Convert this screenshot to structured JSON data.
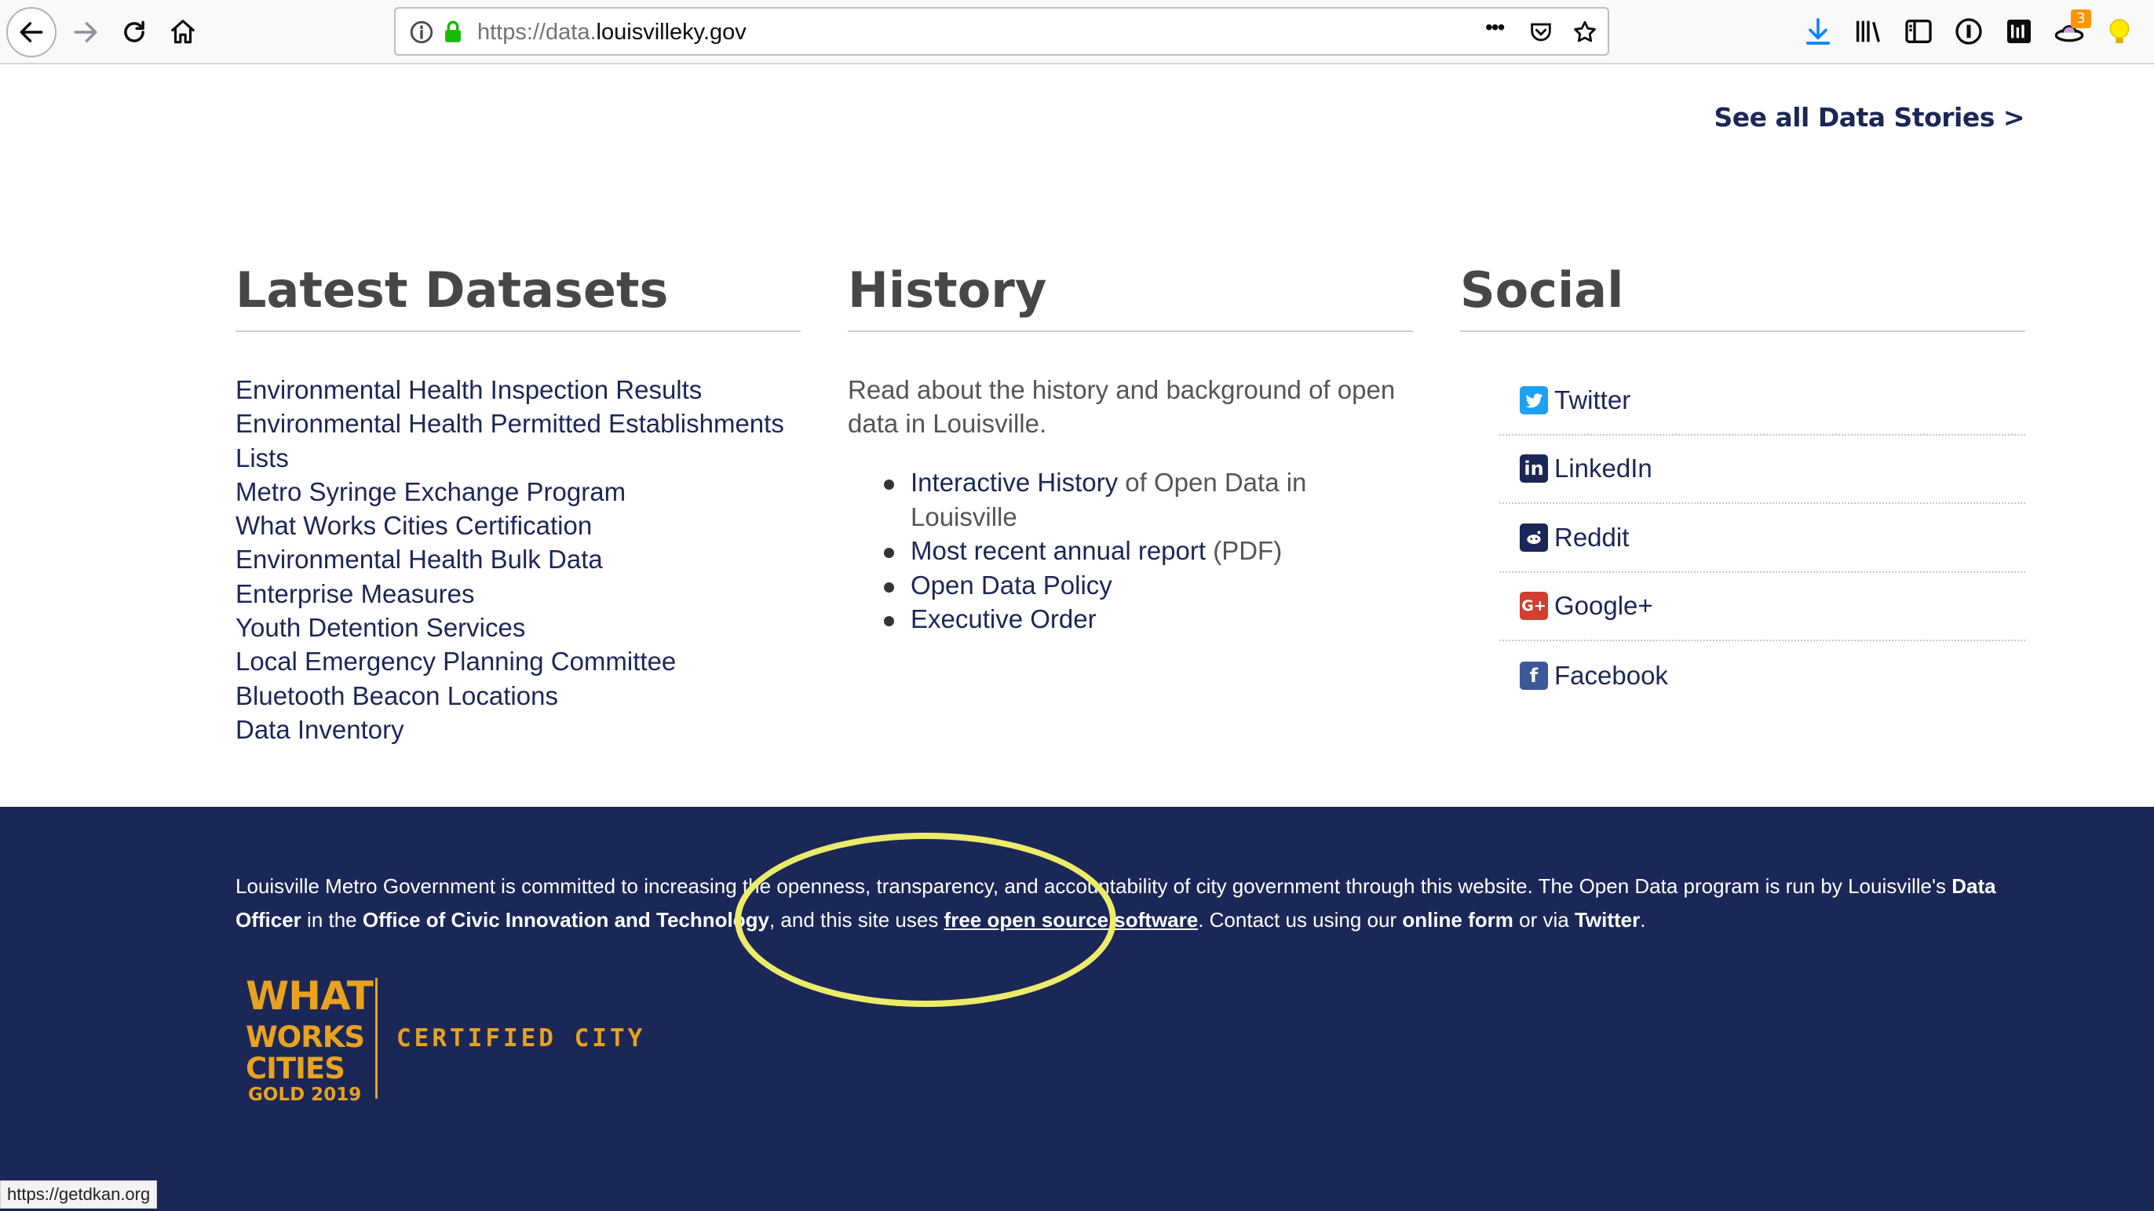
{
  "browser": {
    "url_prefix": "https://data.",
    "url_host": "louisvilleky.gov",
    "overflow_glyph": "•••",
    "notification_count": "3",
    "status_url": "https://getdkan.org"
  },
  "data_stories": {
    "link_label": "See all Data Stories >"
  },
  "datasets": {
    "heading": "Latest Datasets",
    "items": [
      "Environmental Health Inspection Results",
      "Environmental Health Permitted Establishments",
      "Lists",
      "Metro Syringe Exchange Program",
      "What Works Cities Certification",
      "Environmental Health Bulk Data",
      "Enterprise Measures",
      "Youth Detention Services",
      "Local Emergency Planning Committee",
      "Bluetooth Beacon Locations",
      "Data Inventory"
    ]
  },
  "history": {
    "heading": "History",
    "intro": "Read about the history and background of open data in Louisville.",
    "items": [
      {
        "link": "Interactive History",
        "suffix": " of Open Data in Louisville"
      },
      {
        "link": "Most recent annual report",
        "suffix": " (PDF)"
      },
      {
        "link": "Open Data Policy",
        "suffix": ""
      },
      {
        "link": "Executive Order",
        "suffix": ""
      }
    ]
  },
  "social": {
    "heading": "Social",
    "items": [
      {
        "label": "Twitter",
        "icon": "twitter-icon",
        "color": "#1da1f2"
      },
      {
        "label": "LinkedIn",
        "icon": "linkedin-icon",
        "color": "#1b2757"
      },
      {
        "label": "Reddit",
        "icon": "reddit-icon",
        "color": "#1b2757"
      },
      {
        "label": "Google+",
        "icon": "google-plus-icon",
        "color": "#d23f31"
      },
      {
        "label": "Facebook",
        "icon": "facebook-icon",
        "color": "#3b5998"
      }
    ]
  },
  "footer": {
    "p1": "Louisville Metro Government is committed to increasing the openness, transparency, and accountability of city government through this website. The Open Data program is run by Louisville's ",
    "data_officer": "Data Officer",
    "p2": " in the ",
    "office": "Office of Civic Innovation and Technology",
    "p3": ", and this site uses ",
    "oss": "free open source software",
    "p4": ". Contact us using our ",
    "online_form": "online form",
    "p5": " or via ",
    "twitter": "Twitter",
    "p6": "."
  },
  "badge": {
    "line1": "WHAT",
    "line2": "WORKS",
    "line3": "CITIES",
    "line4": "GOLD 2019",
    "certified": "CERTIFIED CITY"
  },
  "colors": {
    "navy": "#1b2757",
    "gold": "#e7a21f",
    "highlight": "#ecec6a"
  }
}
